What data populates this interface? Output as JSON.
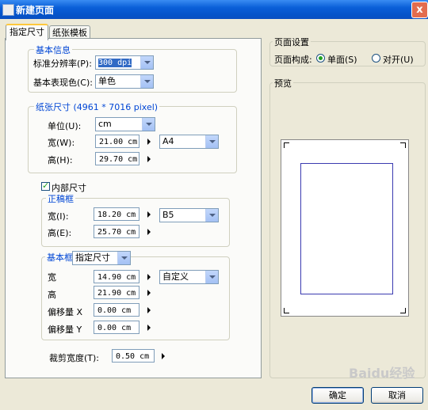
{
  "window": {
    "title": "新建页面",
    "close": "x"
  },
  "tabs": [
    "指定尺寸",
    "纸张模板"
  ],
  "basic_info": {
    "legend": "基本信息",
    "resolution_label": "标准分辨率(P):",
    "resolution_value": "300 dpi",
    "color_label": "基本表现色(C):",
    "color_value": "单色"
  },
  "paper_size": {
    "legend": "纸张尺寸 (4961 * 7016 pixel)",
    "unit_label": "单位(U):",
    "unit_value": "cm",
    "width_label": "宽(W):",
    "width_value": "21.00 cm",
    "height_label": "高(H):",
    "height_value": "29.70 cm",
    "template_value": "A4"
  },
  "inner_size": {
    "checkbox_label": "内部尺寸",
    "checked": true,
    "draft_frame": {
      "legend": "正稿框",
      "width_label": "宽(I):",
      "width_value": "18.20 cm",
      "height_label": "高(E):",
      "height_value": "25.70 cm",
      "template_value": "B5"
    },
    "base_frame": {
      "legend": "基本框",
      "mode_value": "指定尺寸",
      "width_label": "宽",
      "width_value": "14.90 cm",
      "height_label": "高",
      "height_value": "21.90 cm",
      "offset_x_label": "偏移量 X",
      "offset_x_value": "0.00 cm",
      "offset_y_label": "偏移量 Y",
      "offset_y_value": "0.00 cm",
      "template_value": "自定义"
    }
  },
  "bleed": {
    "label": "裁剪宽度(T):",
    "value": "0.50 cm"
  },
  "page_settings": {
    "legend": "页面设置",
    "layout_label": "页面构成:",
    "single_label": "单面(S)",
    "spread_label": "对开(U)",
    "selected": "single"
  },
  "preview": {
    "legend": "预览"
  },
  "buttons": {
    "ok": "确定",
    "cancel": "取消"
  },
  "watermark": "Baidu经验"
}
